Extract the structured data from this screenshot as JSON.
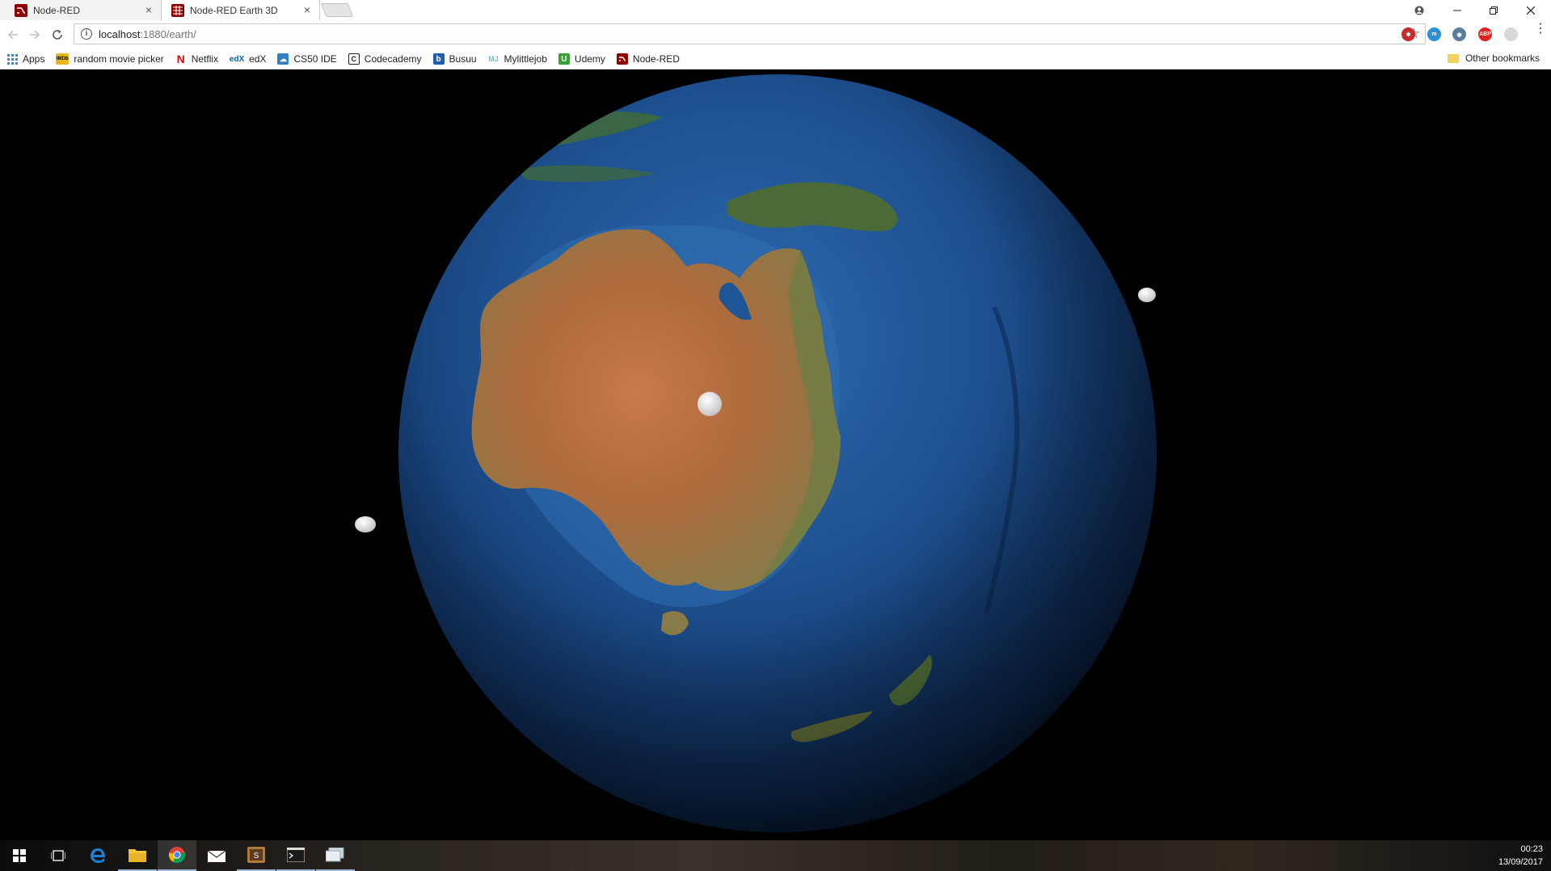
{
  "browser": {
    "tabs": [
      {
        "title": "Node-RED",
        "favicon": "node-red-icon",
        "active": false
      },
      {
        "title": "Node-RED Earth 3D",
        "favicon": "node-red-earth-icon",
        "active": true
      }
    ],
    "address": {
      "host": "localhost",
      "rest": ":1880/earth/"
    },
    "bookmarks": [
      {
        "label": "Apps",
        "icon": "apps-grid-icon"
      },
      {
        "label": "random movie picker",
        "icon": "imdb-icon"
      },
      {
        "label": "Netflix",
        "icon": "netflix-icon"
      },
      {
        "label": "edX",
        "icon": "edx-icon"
      },
      {
        "label": "CS50 IDE",
        "icon": "cs50-icon"
      },
      {
        "label": "Codecademy",
        "icon": "codecademy-icon"
      },
      {
        "label": "Busuu",
        "icon": "busuu-icon"
      },
      {
        "label": "Mylittlejob",
        "icon": "mylittlejob-icon"
      },
      {
        "label": "Udemy",
        "icon": "udemy-icon"
      },
      {
        "label": "Node-RED",
        "icon": "node-red-icon"
      }
    ],
    "other_bookmarks": "Other bookmarks"
  },
  "scene": {
    "background": "#000000",
    "globe_view": "Australia / Pacific",
    "markers": [
      "marker-center",
      "marker-right",
      "marker-left"
    ]
  },
  "taskbar": {
    "items": [
      "start-icon",
      "task-view-icon",
      "edge-icon",
      "file-explorer-icon",
      "chrome-icon",
      "mail-icon",
      "app-icon",
      "terminal-icon",
      "remote-icon"
    ],
    "time": "00:23",
    "date": "13/09/2017"
  },
  "colors": {
    "accent": "#9bb7d8",
    "nodered": "#8f0000"
  }
}
